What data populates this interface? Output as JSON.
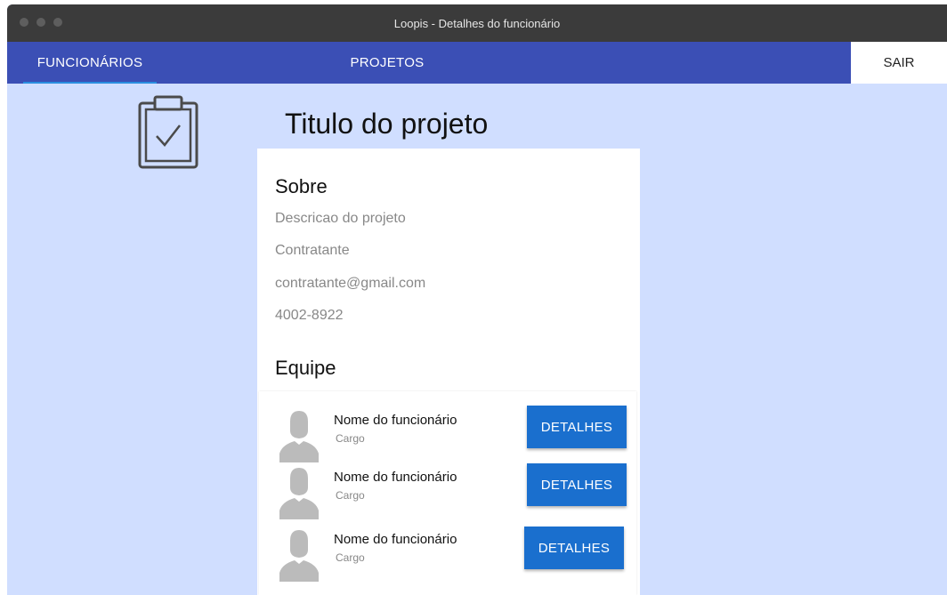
{
  "window": {
    "title": "Loopis - Detalhes do funcionário"
  },
  "nav": {
    "tabs": [
      {
        "label": "FUNCIONÁRIOS",
        "active": true
      },
      {
        "label": "PROJETOS",
        "active": false
      }
    ],
    "logout_label": "SAIR"
  },
  "project": {
    "title": "Titulo do projeto",
    "about_heading": "Sobre",
    "description": "Descricao do projeto",
    "client": "Contratante",
    "email": "contratante@gmail.com",
    "phone": "4002-8922",
    "team_heading": "Equipe"
  },
  "team": [
    {
      "name": "Nome do funcionário",
      "role": "Cargo",
      "button": "DETALHES"
    },
    {
      "name": "Nome do funcionário",
      "role": "Cargo",
      "button": "DETALHES"
    },
    {
      "name": "Nome do funcionário",
      "role": "Cargo",
      "button": "DETALHES"
    }
  ],
  "colors": {
    "navbar": "#3b4fb5",
    "background": "#d0deff",
    "button": "#1a6fce",
    "tab_indicator": "#2a8ee0"
  },
  "icons": {
    "project": "clipboard-check-icon",
    "member": "person-avatar-icon"
  }
}
